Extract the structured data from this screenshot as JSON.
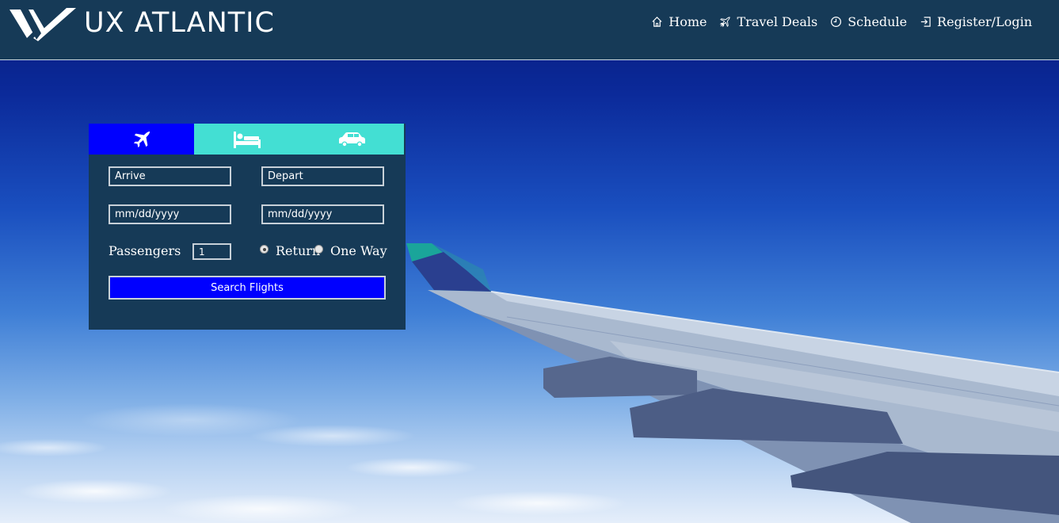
{
  "brand": {
    "name": "UX ATLANTIC"
  },
  "nav": {
    "items": [
      {
        "label": "Home",
        "icon": "home-icon"
      },
      {
        "label": "Travel Deals",
        "icon": "airplane-icon"
      },
      {
        "label": "Schedule",
        "icon": "clock-icon"
      },
      {
        "label": "Register/Login",
        "icon": "sign-in-icon"
      }
    ]
  },
  "booking": {
    "tabs": [
      {
        "name": "flights",
        "icon": "airplane-icon",
        "active": true
      },
      {
        "name": "hotels",
        "icon": "bed-icon",
        "active": false
      },
      {
        "name": "cars",
        "icon": "car-icon",
        "active": false
      }
    ],
    "arrive_placeholder": "Arrive",
    "depart_placeholder": "Depart",
    "arrive_date_placeholder": "mm/dd/yyyy",
    "depart_date_placeholder": "mm/dd/yyyy",
    "passengers_label": "Passengers",
    "passengers_value": "1",
    "trip_type": {
      "options": [
        "Return",
        "One Way"
      ],
      "selected": "Return"
    },
    "search_label": "Search Flights"
  },
  "colors": {
    "header_bg": "#163a57",
    "active_tab": "#0000ff",
    "inactive_tab": "#43dfd3",
    "button_bg": "#0000ff"
  }
}
